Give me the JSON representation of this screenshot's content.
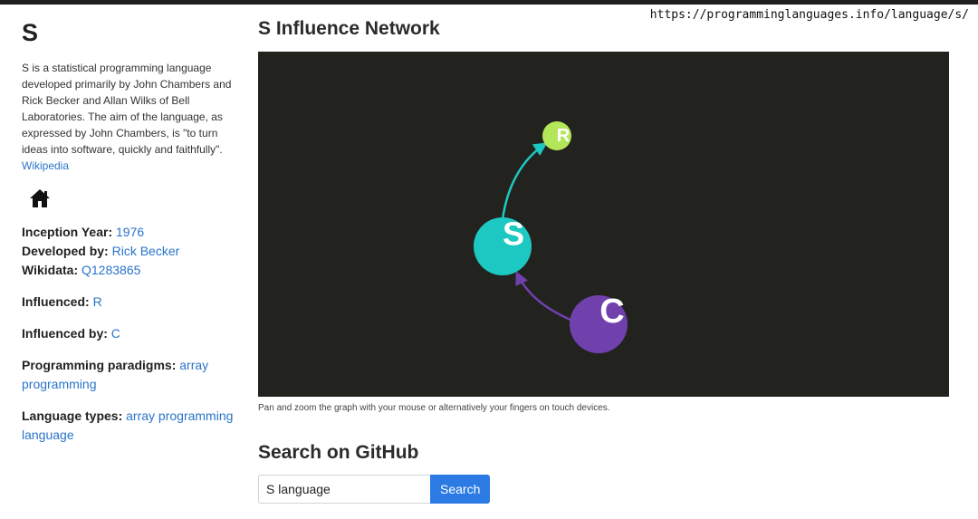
{
  "url": "https://programminglanguages.info/language/s/",
  "language": {
    "name": "S",
    "description": "S is a statistical programming language developed primarily by John Chambers and Rick Becker and Allan Wilks of Bell Laboratories. The aim of the language, as expressed by John Chambers, is \"to turn ideas into software, quickly and faithfully\".",
    "wikipedia_link": "Wikipedia"
  },
  "icons": {
    "home": "home-icon"
  },
  "facts": {
    "inception_label": "Inception Year:",
    "inception_value": "1976",
    "developed_label": "Developed by:",
    "developed_value": "Rick Becker",
    "wikidata_label": "Wikidata:",
    "wikidata_value": "Q1283865",
    "influenced_label": "Influenced:",
    "influenced_value": "R",
    "influenced_by_label": "Influenced by:",
    "influenced_by_value": "C",
    "paradigms_label": "Programming paradigms:",
    "paradigms_value": "array programming",
    "types_label": "Language types:",
    "types_value": "array programming language"
  },
  "network": {
    "title": "S Influence Network",
    "caption": "Pan and zoom the graph with your mouse or alternatively your fingers on touch devices.",
    "nodes": [
      {
        "label": "S",
        "color": "#1ec8c2"
      },
      {
        "label": "R",
        "color": "#b4e65a"
      },
      {
        "label": "C",
        "color": "#7040ad"
      }
    ],
    "edges": [
      {
        "from": "S",
        "to": "R",
        "color": "#1ec8c2"
      },
      {
        "from": "C",
        "to": "S",
        "color": "#7040ad"
      }
    ],
    "background": "#22221e"
  },
  "search": {
    "title": "Search on GitHub",
    "value": "S language",
    "button": "Search"
  },
  "colors": {
    "link": "#2a74c9",
    "button": "#2c7be5"
  }
}
